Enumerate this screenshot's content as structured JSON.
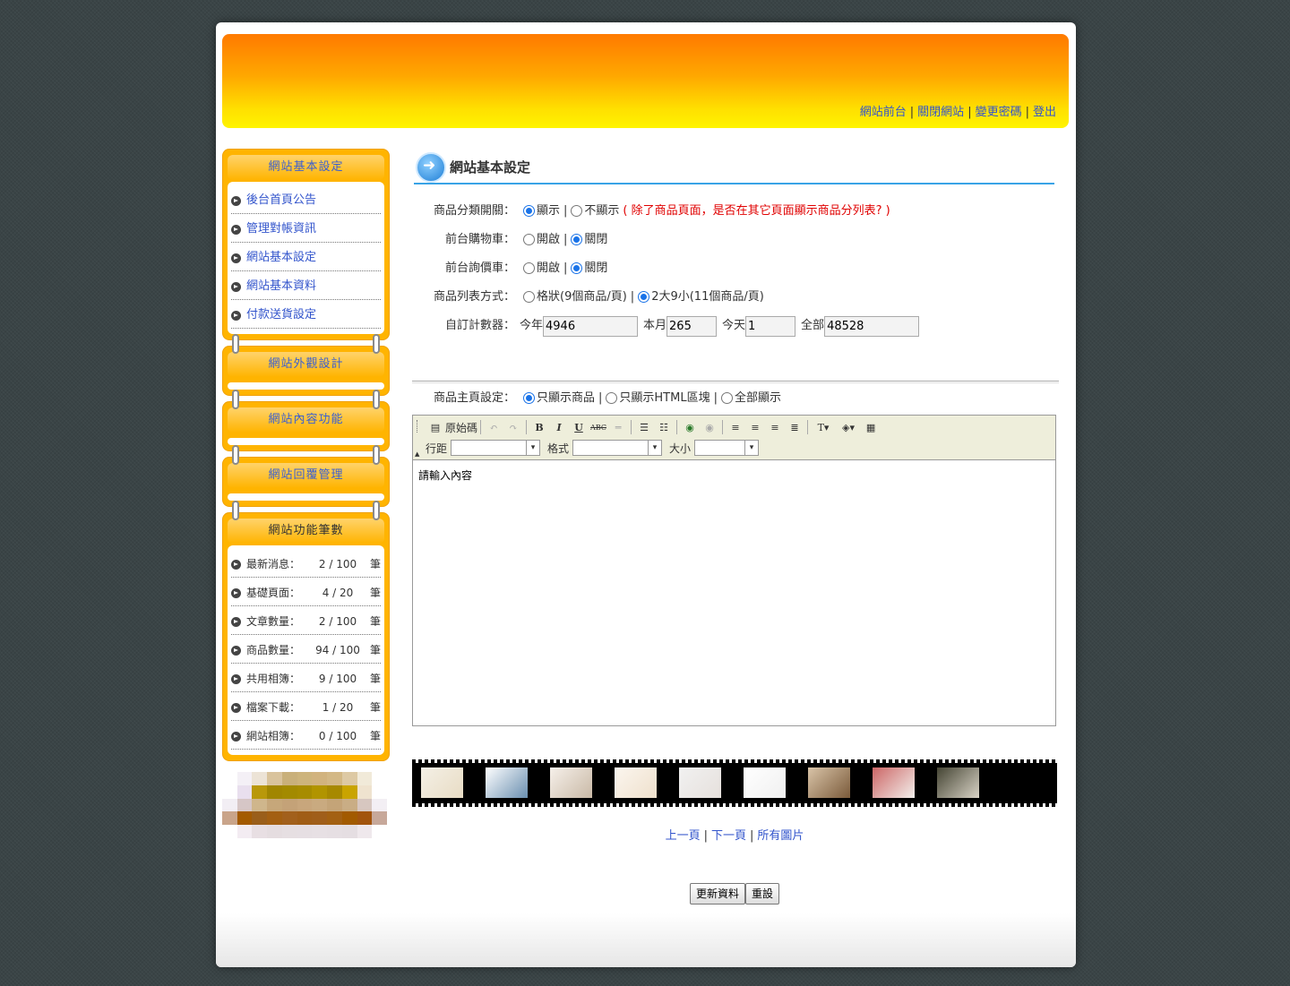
{
  "header": {
    "links": [
      "網站前台",
      "關閉網站",
      "變更密碼",
      "登出"
    ],
    "separator": "|"
  },
  "sidebar": {
    "menus": [
      {
        "title": "網站基本設定",
        "items": [
          "後台首頁公告",
          "管理對帳資訊",
          "網站基本設定",
          "網站基本資料",
          "付款送貨設定"
        ]
      },
      {
        "title": "網站外觀設計",
        "items": []
      },
      {
        "title": "網站內容功能",
        "items": []
      },
      {
        "title": "網站回覆管理",
        "items": []
      }
    ],
    "counts": {
      "title": "網站功能筆數",
      "unit": "筆",
      "rows": [
        {
          "name": "最新消息：",
          "value": "2 / 100"
        },
        {
          "name": "基礎頁面：",
          "value": "4 / 20"
        },
        {
          "name": "文章數量：",
          "value": "2 / 100"
        },
        {
          "name": "商品數量：",
          "value": "94 / 100"
        },
        {
          "name": "共用相簿：",
          "value": "9 / 100"
        },
        {
          "name": "檔案下載：",
          "value": "1 / 20"
        },
        {
          "name": "網站相簿：",
          "value": "0 / 100"
        }
      ]
    }
  },
  "main": {
    "title": "網站基本設定",
    "category_switch": {
      "label": "商品分類開關：",
      "opt1": "顯示",
      "opt2": "不顯示",
      "note": "( 除了商品頁面，是否在其它頁面顯示商品分列表? )",
      "sep": "|"
    },
    "cart": {
      "label": "前台購物車：",
      "opt1": "開啟",
      "opt2": "關閉",
      "sep": "|"
    },
    "inquiry": {
      "label": "前台詢價車：",
      "opt1": "開啟",
      "opt2": "關閉",
      "sep": "|"
    },
    "list_mode": {
      "label": "商品列表方式：",
      "opt1": "格狀(9個商品/頁)",
      "opt2": "2大9小(11個商品/頁)",
      "sep": "|"
    },
    "counter": {
      "label": "自訂計數器：",
      "year_label": "今年",
      "year": "4946",
      "month_label": "本月",
      "month": "265",
      "day_label": "今天",
      "day": "1",
      "total_label": "全部",
      "total": "48528"
    },
    "home": {
      "label": "商品主頁設定：",
      "opt1": "只顯示商品",
      "opt2": "只顯示HTML區塊",
      "opt3": "全部顯示",
      "sep": "|"
    },
    "editor": {
      "source": "原始碼",
      "line_height": "行距",
      "format": "格式",
      "size": "大小",
      "placeholder": "請輸入內容"
    },
    "pager": {
      "prev": "上一頁",
      "next": "下一頁",
      "all": "所有圖片",
      "sep": "|"
    },
    "buttons": {
      "submit": "更新資料",
      "reset": "重設"
    }
  },
  "colors": {
    "banner_top": "#ff7a00",
    "banner_bottom": "#fff400",
    "sidebar": "#ffb400",
    "link": "#3355cc",
    "accent_line": "#39a3e6",
    "note": "#e00000"
  }
}
